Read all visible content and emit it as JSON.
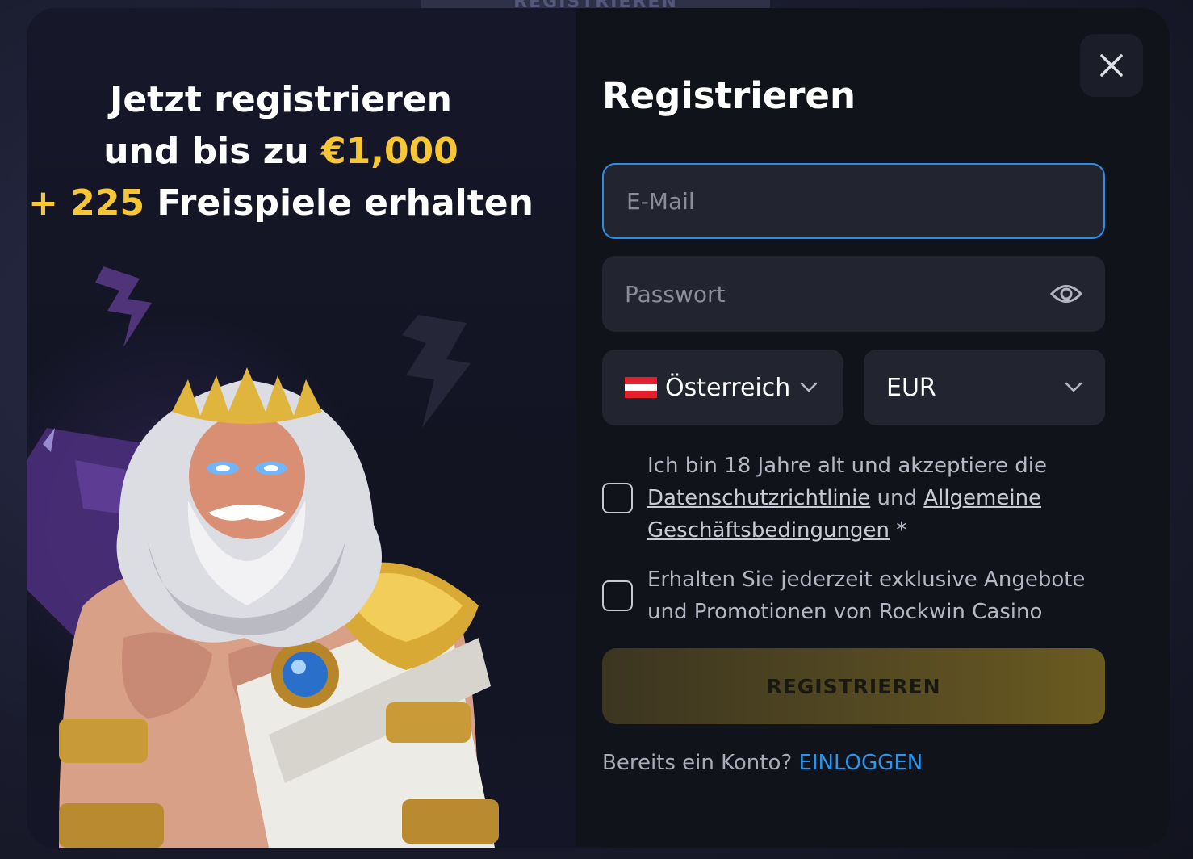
{
  "background": {
    "top_ghost_label": "REGISTRIEREN"
  },
  "promo": {
    "line1": "Jetzt registrieren",
    "line2_prefix": "und bis zu ",
    "line2_amount": "€1,000",
    "line3_bonus": "+ 225",
    "line3_suffix": " Freispiele erhalten",
    "accent_color": "#f6c634",
    "character_icon": "zeus-character-illustration"
  },
  "form": {
    "title": "Registrieren",
    "close_icon": "close-icon",
    "email": {
      "placeholder": "E-Mail",
      "value": ""
    },
    "password": {
      "placeholder": "Passwort",
      "value": "",
      "toggle_icon": "eye-icon"
    },
    "country": {
      "selected": "Österreich",
      "flag": "austria-flag-icon"
    },
    "currency": {
      "selected": "EUR"
    },
    "terms": {
      "text_before": "Ich bin 18 Jahre alt und akzeptiere die ",
      "privacy_link": "Datenschutzrichtlinie",
      "text_mid": " und ",
      "terms_link": "Allgemeine Geschäftsbedingungen",
      "required_mark": " *",
      "checked": false
    },
    "promotions": {
      "text": "Erhalten Sie jederzeit exklusive Angebote und Promotionen von Rockwin Casino",
      "checked": false
    },
    "submit_label": "REGISTRIEREN",
    "login_prompt": "Bereits ein Konto? ",
    "login_link": "EINLOGGEN"
  },
  "colors": {
    "focus_border": "#2a8ee6",
    "link_blue": "#2a95ec",
    "button_gold": "#6b5b20"
  }
}
